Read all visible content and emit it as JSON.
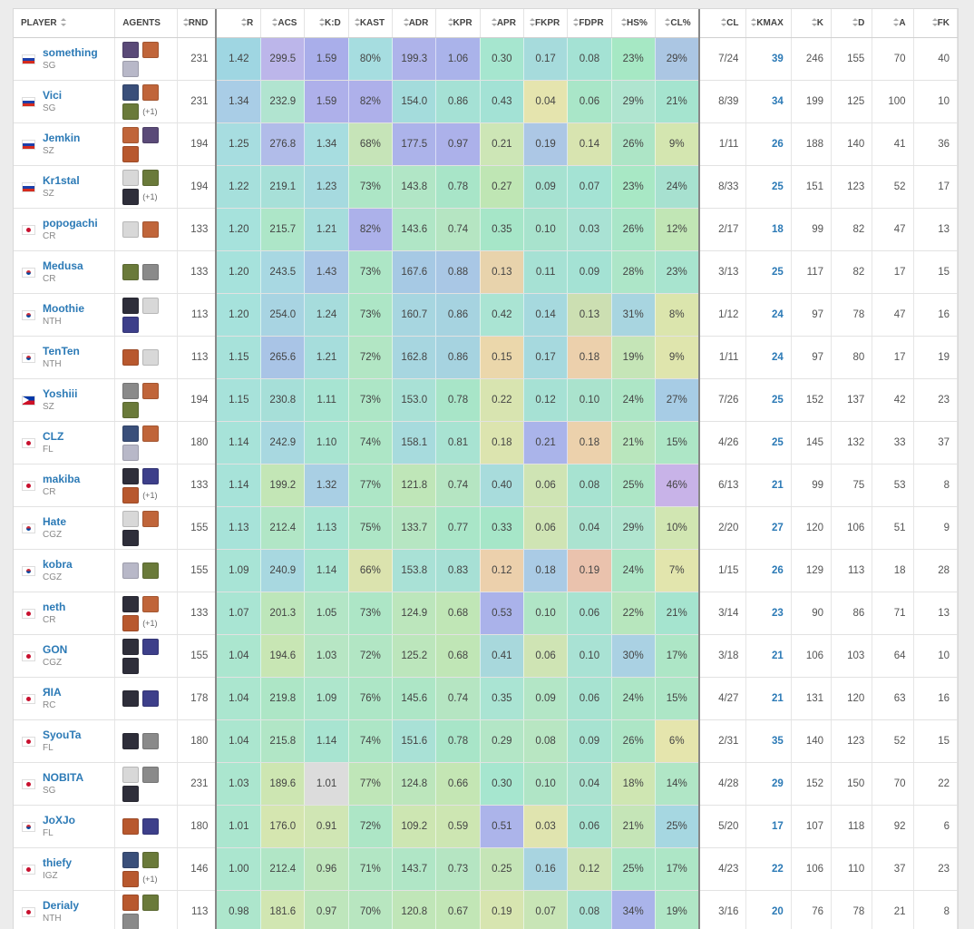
{
  "columns": [
    "PLAYER",
    "AGENTS",
    "RND",
    "R",
    "ACS",
    "K:D",
    "KAST",
    "ADR",
    "KPR",
    "APR",
    "FKPR",
    "FDPR",
    "HS%",
    "CL%",
    "CL",
    "KMAX",
    "K",
    "D",
    "A",
    "FK"
  ],
  "agent_palette": [
    "#5a4a78",
    "#c0653a",
    "#b8b8c8",
    "#3a4f7a",
    "#6a7a3a",
    "#8a8a8a",
    "#2e2e3a",
    "#b8582e",
    "#3d3f8a",
    "#d8d8d8"
  ],
  "rows": [
    {
      "name": "something",
      "team": "SG",
      "country": "ru",
      "agents": [
        0,
        1,
        2
      ],
      "more": "",
      "rnd": "231",
      "r": "1.42",
      "acs": "299.5",
      "kd": "1.59",
      "kast": "80%",
      "adr": "199.3",
      "kpr": "1.06",
      "apr": "0.30",
      "fkpr": "0.17",
      "fdpr": "0.08",
      "hs": "23%",
      "clp": "29%",
      "cl": "7/24",
      "kmax": "39",
      "k": "246",
      "d": "155",
      "a": "70",
      "fk": "40",
      "colors": [
        "#9fd6e2",
        "#bcb6ea",
        "#a9aeea",
        "#a6dde0",
        "#aeb3ea",
        "#aab3ea",
        "#a6e6cf",
        "#a6dbdc",
        "#a4e2d4",
        "#a6e8c4",
        "#abc6e3"
      ]
    },
    {
      "name": "Vici",
      "team": "SG",
      "country": "ru",
      "agents": [
        3,
        1,
        4
      ],
      "more": "(+1)",
      "rnd": "231",
      "r": "1.34",
      "acs": "232.9",
      "kd": "1.59",
      "kast": "82%",
      "adr": "154.0",
      "kpr": "0.86",
      "apr": "0.43",
      "fkpr": "0.04",
      "fdpr": "0.06",
      "hs": "29%",
      "clp": "21%",
      "cl": "8/39",
      "kmax": "34",
      "k": "199",
      "d": "125",
      "a": "100",
      "fk": "10",
      "colors": [
        "#a9cde6",
        "#b1e4d0",
        "#aeb0ea",
        "#aeb0ea",
        "#a4dcdc",
        "#a5e1d5",
        "#a3e2d5",
        "#e5e4ae",
        "#a9e6c8",
        "#b0e5d0",
        "#a5e4cf"
      ]
    },
    {
      "name": "Jemkin",
      "team": "SZ",
      "country": "ru",
      "agents": [
        1,
        0,
        7
      ],
      "more": "",
      "rnd": "194",
      "r": "1.25",
      "acs": "276.8",
      "kd": "1.34",
      "kast": "68%",
      "adr": "177.5",
      "kpr": "0.97",
      "apr": "0.21",
      "fkpr": "0.19",
      "fdpr": "0.14",
      "hs": "26%",
      "clp": "9%",
      "cl": "1/11",
      "kmax": "26",
      "k": "188",
      "d": "140",
      "a": "41",
      "fk": "36",
      "colors": [
        "#a7dde0",
        "#b1bce9",
        "#a7dde0",
        "#c6e4b8",
        "#acb3ea",
        "#acb1ea",
        "#cde6b6",
        "#acc7e5",
        "#d8e4b0",
        "#ade5c6",
        "#d4e6b0"
      ]
    },
    {
      "name": "Kr1stal",
      "team": "SZ",
      "country": "ru",
      "agents": [
        9,
        4,
        6
      ],
      "more": "(+1)",
      "rnd": "194",
      "r": "1.22",
      "acs": "219.1",
      "kd": "1.23",
      "kast": "73%",
      "adr": "143.8",
      "kpr": "0.78",
      "apr": "0.27",
      "fkpr": "0.09",
      "fdpr": "0.07",
      "hs": "23%",
      "clp": "24%",
      "cl": "8/33",
      "kmax": "25",
      "k": "151",
      "d": "123",
      "a": "52",
      "fk": "17",
      "colors": [
        "#a6e0dc",
        "#a7e0d8",
        "#a6dadf",
        "#ade6c6",
        "#b1e6c6",
        "#a8e5c8",
        "#bfe6b4",
        "#a6e2d1",
        "#a4e3d4",
        "#a8e8c5",
        "#a7e1d0"
      ]
    },
    {
      "name": "popogachi",
      "team": "CR",
      "country": "jp",
      "agents": [
        9,
        1
      ],
      "more": "",
      "rnd": "133",
      "r": "1.20",
      "acs": "215.7",
      "kd": "1.21",
      "kast": "82%",
      "adr": "143.6",
      "kpr": "0.74",
      "apr": "0.35",
      "fkpr": "0.10",
      "fdpr": "0.03",
      "hs": "26%",
      "clp": "12%",
      "cl": "2/17",
      "kmax": "18",
      "k": "99",
      "d": "82",
      "a": "47",
      "fk": "13",
      "colors": [
        "#a6e2dc",
        "#ade6c8",
        "#a6dddc",
        "#acb1ea",
        "#b0e6c6",
        "#b5e5c2",
        "#a6e6c8",
        "#a8e3cd",
        "#a9e2d4",
        "#a9e6c8",
        "#c1e6b5"
      ]
    },
    {
      "name": "Medusa",
      "team": "CR",
      "country": "kr",
      "agents": [
        4,
        5
      ],
      "more": "",
      "rnd": "133",
      "r": "1.20",
      "acs": "243.5",
      "kd": "1.43",
      "kast": "73%",
      "adr": "167.6",
      "kpr": "0.88",
      "apr": "0.13",
      "fkpr": "0.11",
      "fdpr": "0.09",
      "hs": "28%",
      "clp": "23%",
      "cl": "3/13",
      "kmax": "25",
      "k": "117",
      "d": "82",
      "a": "17",
      "fk": "15",
      "colors": [
        "#a6e2dc",
        "#a8d8e2",
        "#a9c6e6",
        "#ade6c6",
        "#a6c9e4",
        "#a9c7e5",
        "#e8d3ac",
        "#a6e1d4",
        "#a4e2d4",
        "#ade6c8",
        "#a8e4cf"
      ]
    },
    {
      "name": "Moothie",
      "team": "NTH",
      "country": "kr",
      "agents": [
        6,
        9,
        8
      ],
      "more": "",
      "rnd": "113",
      "r": "1.20",
      "acs": "254.0",
      "kd": "1.24",
      "kast": "73%",
      "adr": "160.7",
      "kpr": "0.86",
      "apr": "0.42",
      "fkpr": "0.14",
      "fdpr": "0.13",
      "hs": "31%",
      "clp": "8%",
      "cl": "1/12",
      "kmax": "24",
      "k": "97",
      "d": "78",
      "a": "47",
      "fk": "16",
      "colors": [
        "#a6e2dc",
        "#a8d4e2",
        "#a6dcdc",
        "#ade6c6",
        "#a7d6e0",
        "#a6d3e0",
        "#aae4d3",
        "#a6d9de",
        "#ccdfb2",
        "#a8d5e0",
        "#dbe5ad"
      ]
    },
    {
      "name": "TenTen",
      "team": "NTH",
      "country": "kr",
      "agents": [
        7,
        9
      ],
      "more": "",
      "rnd": "113",
      "r": "1.15",
      "acs": "265.6",
      "kd": "1.21",
      "kast": "72%",
      "adr": "162.8",
      "kpr": "0.86",
      "apr": "0.15",
      "fkpr": "0.17",
      "fdpr": "0.18",
      "hs": "19%",
      "clp": "9%",
      "cl": "1/11",
      "kmax": "24",
      "k": "97",
      "d": "80",
      "a": "17",
      "fk": "19",
      "colors": [
        "#a7e2da",
        "#a9c4e6",
        "#a6dddc",
        "#b2e6c4",
        "#a7d6e0",
        "#a6d3e0",
        "#ebd7ab",
        "#a6d9de",
        "#ecd0ac",
        "#c5e5b7",
        "#dfe5ad"
      ]
    },
    {
      "name": "Yoshiii",
      "team": "SZ",
      "country": "ph",
      "agents": [
        5,
        1,
        4
      ],
      "more": "",
      "rnd": "194",
      "r": "1.15",
      "acs": "230.8",
      "kd": "1.11",
      "kast": "73%",
      "adr": "153.0",
      "kpr": "0.78",
      "apr": "0.22",
      "fkpr": "0.12",
      "fdpr": "0.10",
      "hs": "24%",
      "clp": "27%",
      "cl": "7/26",
      "kmax": "25",
      "k": "152",
      "d": "137",
      "a": "42",
      "fk": "23",
      "colors": [
        "#a7e2da",
        "#a6dfd8",
        "#a7e4d2",
        "#ade6c6",
        "#a9e1d6",
        "#a8e5c8",
        "#d8e4b0",
        "#a6e1d4",
        "#aae3cd",
        "#ade6c6",
        "#a7cce5"
      ]
    },
    {
      "name": "CLZ",
      "team": "FL",
      "country": "jp",
      "agents": [
        3,
        1,
        2
      ],
      "more": "",
      "rnd": "180",
      "r": "1.14",
      "acs": "242.9",
      "kd": "1.10",
      "kast": "74%",
      "adr": "158.1",
      "kpr": "0.81",
      "apr": "0.18",
      "fkpr": "0.21",
      "fdpr": "0.18",
      "hs": "21%",
      "clp": "15%",
      "cl": "4/26",
      "kmax": "25",
      "k": "145",
      "d": "132",
      "a": "33",
      "fk": "37",
      "colors": [
        "#a7e3d9",
        "#a8d8e0",
        "#a8e4d1",
        "#ade6c6",
        "#a7dbdd",
        "#a8e3d2",
        "#dce4af",
        "#aab4ea",
        "#ecd1ac",
        "#b9e6bd",
        "#ade6c6"
      ]
    },
    {
      "name": "makiba",
      "team": "CR",
      "country": "jp",
      "agents": [
        6,
        8,
        7
      ],
      "more": "(+1)",
      "rnd": "133",
      "r": "1.14",
      "acs": "199.2",
      "kd": "1.32",
      "kast": "77%",
      "adr": "121.8",
      "kpr": "0.74",
      "apr": "0.40",
      "fkpr": "0.06",
      "fdpr": "0.08",
      "hs": "25%",
      "clp": "46%",
      "cl": "6/13",
      "kmax": "21",
      "k": "99",
      "d": "75",
      "a": "53",
      "fk": "8",
      "colors": [
        "#a7e3d9",
        "#c3e6b6",
        "#a9cfe4",
        "#adE6c6",
        "#bfe6b8",
        "#b5e5c2",
        "#a8dcdc",
        "#cfe4b4",
        "#a7e3d1",
        "#ade6c6",
        "#c8b3e8"
      ]
    },
    {
      "name": "Hate",
      "team": "CGZ",
      "country": "kr",
      "agents": [
        9,
        1,
        6
      ],
      "more": "",
      "rnd": "155",
      "r": "1.13",
      "acs": "212.4",
      "kd": "1.13",
      "kast": "75%",
      "adr": "133.7",
      "kpr": "0.77",
      "apr": "0.33",
      "fkpr": "0.06",
      "fdpr": "0.04",
      "hs": "29%",
      "clp": "10%",
      "cl": "2/20",
      "kmax": "27",
      "k": "120",
      "d": "106",
      "a": "51",
      "fk": "9",
      "colors": [
        "#a7e3d9",
        "#b1e6c6",
        "#a8e4d2",
        "#ade6c6",
        "#b6e6c2",
        "#a9e6c8",
        "#a6e6c8",
        "#cfe4b4",
        "#abe3d0",
        "#b0e5d0",
        "#d1e6b2"
      ]
    },
    {
      "name": "kobra",
      "team": "CGZ",
      "country": "kr",
      "agents": [
        2,
        4
      ],
      "more": "",
      "rnd": "155",
      "r": "1.09",
      "acs": "240.9",
      "kd": "1.14",
      "kast": "66%",
      "adr": "153.8",
      "kpr": "0.83",
      "apr": "0.12",
      "fkpr": "0.18",
      "fdpr": "0.19",
      "hs": "24%",
      "clp": "7%",
      "cl": "1/15",
      "kmax": "26",
      "k": "129",
      "d": "113",
      "a": "18",
      "fk": "28",
      "colors": [
        "#a8e4d6",
        "#a8d8e0",
        "#a8e4d1",
        "#dbe3ae",
        "#a9e1d6",
        "#a7e0d5",
        "#ecd0ac",
        "#aacbe5",
        "#eac2ad",
        "#ade6c6",
        "#e2e5ad"
      ]
    },
    {
      "name": "neth",
      "team": "CR",
      "country": "jp",
      "agents": [
        6,
        1,
        7
      ],
      "more": "(+1)",
      "rnd": "133",
      "r": "1.07",
      "acs": "201.3",
      "kd": "1.05",
      "kast": "73%",
      "adr": "124.9",
      "kpr": "0.68",
      "apr": "0.53",
      "fkpr": "0.10",
      "fdpr": "0.06",
      "hs": "22%",
      "clp": "21%",
      "cl": "3/14",
      "kmax": "23",
      "k": "90",
      "d": "86",
      "a": "71",
      "fk": "13",
      "colors": [
        "#a9e5d3",
        "#bde6ba",
        "#b3e6c6",
        "#ade6c6",
        "#bce6bc",
        "#c0e6b6",
        "#aab2ea",
        "#b0e5c6",
        "#a7e3d1",
        "#b7e6bd",
        "#a5e4cf"
      ]
    },
    {
      "name": "GON",
      "team": "CGZ",
      "country": "jp",
      "agents": [
        6,
        8,
        6
      ],
      "more": "",
      "rnd": "155",
      "r": "1.04",
      "acs": "194.6",
      "kd": "1.03",
      "kast": "72%",
      "adr": "125.2",
      "kpr": "0.68",
      "apr": "0.41",
      "fkpr": "0.06",
      "fdpr": "0.10",
      "hs": "30%",
      "clp": "17%",
      "cl": "3/18",
      "kmax": "21",
      "k": "106",
      "d": "103",
      "a": "64",
      "fk": "10",
      "colors": [
        "#abe6cf",
        "#c8e6b4",
        "#b7e6c4",
        "#b2e6c4",
        "#bce6bc",
        "#c0e6b6",
        "#a8d8dc",
        "#cfe4b4",
        "#a9e2d4",
        "#aad1e3",
        "#ade6c6"
      ]
    },
    {
      "name": "ЯIA",
      "team": "RC",
      "country": "jp",
      "agents": [
        6,
        8
      ],
      "more": "",
      "rnd": "178",
      "r": "1.04",
      "acs": "219.8",
      "kd": "1.09",
      "kast": "76%",
      "adr": "145.6",
      "kpr": "0.74",
      "apr": "0.35",
      "fkpr": "0.09",
      "fdpr": "0.06",
      "hs": "24%",
      "clp": "15%",
      "cl": "4/27",
      "kmax": "21",
      "k": "131",
      "d": "120",
      "a": "63",
      "fk": "16",
      "colors": [
        "#abe6cf",
        "#ade6c6",
        "#aee6cc",
        "#ade6c6",
        "#ade6c6",
        "#b5e5c2",
        "#aae4d3",
        "#b3e6c6",
        "#a7e3d1",
        "#ade6c6",
        "#ade6c6"
      ]
    },
    {
      "name": "SyouTa",
      "team": "FL",
      "country": "jp",
      "agents": [
        6,
        5
      ],
      "more": "",
      "rnd": "180",
      "r": "1.04",
      "acs": "215.8",
      "kd": "1.14",
      "kast": "74%",
      "adr": "151.6",
      "kpr": "0.78",
      "apr": "0.29",
      "fkpr": "0.08",
      "fdpr": "0.09",
      "hs": "26%",
      "clp": "6%",
      "cl": "2/31",
      "kmax": "35",
      "k": "140",
      "d": "123",
      "a": "52",
      "fk": "15",
      "colors": [
        "#abe6cf",
        "#b1e6c6",
        "#a8e4d1",
        "#ade6c6",
        "#a9e1d6",
        "#a8e5c8",
        "#b3e6c6",
        "#b8e6c2",
        "#a7e3d1",
        "#ade6c6",
        "#e5e5ad"
      ]
    },
    {
      "name": "NOBITA",
      "team": "SG",
      "country": "jp",
      "agents": [
        9,
        5,
        6
      ],
      "more": "",
      "rnd": "231",
      "r": "1.03",
      "acs": "189.6",
      "kd": "1.01",
      "kast": "77%",
      "adr": "124.8",
      "kpr": "0.66",
      "apr": "0.30",
      "fkpr": "0.10",
      "fdpr": "0.04",
      "hs": "18%",
      "clp": "14%",
      "cl": "4/28",
      "kmax": "29",
      "k": "152",
      "d": "150",
      "a": "70",
      "fk": "22",
      "colors": [
        "#abe6cf",
        "#cde6b2",
        "#dcdcdc",
        "#bfe6b8",
        "#bce6bc",
        "#c4e6b4",
        "#a6e6cf",
        "#b0e5c6",
        "#abe3d0",
        "#cfe6b2",
        "#b0e6c6"
      ]
    },
    {
      "name": "JoXJo",
      "team": "FL",
      "country": "kr",
      "agents": [
        7,
        8
      ],
      "more": "",
      "rnd": "180",
      "r": "1.01",
      "acs": "176.0",
      "kd": "0.91",
      "kast": "72%",
      "adr": "109.2",
      "kpr": "0.59",
      "apr": "0.51",
      "fkpr": "0.03",
      "fdpr": "0.06",
      "hs": "21%",
      "clp": "25%",
      "cl": "5/20",
      "kmax": "17",
      "k": "107",
      "d": "118",
      "a": "92",
      "fk": "6",
      "colors": [
        "#abe6cf",
        "#d5e6b0",
        "#d0e6b4",
        "#ade6c6",
        "#cde6b2",
        "#cde6b2",
        "#acb4ea",
        "#e0e4af",
        "#a7e3d1",
        "#c5e5b7",
        "#a6d7e1"
      ]
    },
    {
      "name": "thiefy",
      "team": "IGZ",
      "country": "jp",
      "agents": [
        3,
        4,
        7
      ],
      "more": "(+1)",
      "rnd": "146",
      "r": "1.00",
      "acs": "212.4",
      "kd": "0.96",
      "kast": "71%",
      "adr": "143.7",
      "kpr": "0.73",
      "apr": "0.25",
      "fkpr": "0.16",
      "fdpr": "0.12",
      "hs": "25%",
      "clp": "17%",
      "cl": "4/23",
      "kmax": "22",
      "k": "106",
      "d": "110",
      "a": "37",
      "fk": "23",
      "colors": [
        "#abe6cf",
        "#b1e6c6",
        "#bfe6bc",
        "#b2e6c4",
        "#b0e6c6",
        "#b5e5c2",
        "#c5e5b7",
        "#a8d4e0",
        "#cfe4b4",
        "#ade6c6",
        "#ade6c6"
      ]
    },
    {
      "name": "Derialy",
      "team": "NTH",
      "country": "jp",
      "agents": [
        7,
        4,
        5
      ],
      "more": "",
      "rnd": "113",
      "r": "0.98",
      "acs": "181.6",
      "kd": "0.97",
      "kast": "70%",
      "adr": "120.8",
      "kpr": "0.67",
      "apr": "0.19",
      "fkpr": "0.07",
      "fdpr": "0.08",
      "hs": "34%",
      "clp": "19%",
      "cl": "3/16",
      "kmax": "20",
      "k": "76",
      "d": "78",
      "a": "21",
      "fk": "8",
      "colors": [
        "#ade6cc",
        "#d1e6b2",
        "#bee6bc",
        "#b8e6c0",
        "#c0e6b8",
        "#c2e6b6",
        "#d7e5b0",
        "#c8e5b6",
        "#a9e2d4",
        "#aab4ea",
        "#b0e6c6"
      ]
    }
  ]
}
